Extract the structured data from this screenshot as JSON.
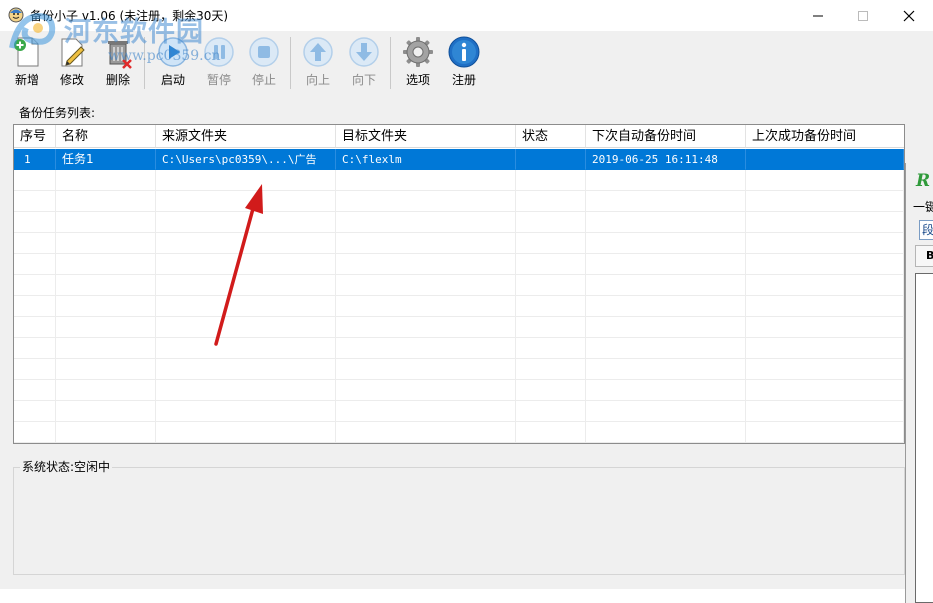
{
  "window": {
    "title": "备份小子 v1.06 (未注册，剩余30天)",
    "minimize_symbol": "—",
    "close_symbol": "✕"
  },
  "watermark": {
    "line1": "河东软件园",
    "line2": "www.pc0359.cn"
  },
  "toolbar": {
    "buttons": [
      {
        "label": "新增",
        "icon": "new-document-icon",
        "enabled": true
      },
      {
        "label": "修改",
        "icon": "edit-icon",
        "enabled": true
      },
      {
        "label": "删除",
        "icon": "delete-icon",
        "enabled": true
      },
      {
        "label": "启动",
        "icon": "play-icon",
        "enabled": true
      },
      {
        "label": "暂停",
        "icon": "pause-icon",
        "enabled": false
      },
      {
        "label": "停止",
        "icon": "stop-icon",
        "enabled": false
      },
      {
        "label": "向上",
        "icon": "arrow-up-icon",
        "enabled": false
      },
      {
        "label": "向下",
        "icon": "arrow-down-icon",
        "enabled": false
      },
      {
        "label": "选项",
        "icon": "gear-icon",
        "enabled": true
      },
      {
        "label": "注册",
        "icon": "info-icon",
        "enabled": true
      }
    ]
  },
  "task_list": {
    "section_label": "备份任务列表:",
    "columns": [
      "序号",
      "名称",
      "来源文件夹",
      "目标文件夹",
      "状态",
      "下次自动备份时间",
      "上次成功备份时间"
    ],
    "rows": [
      {
        "index": "1",
        "name": "任务1",
        "source": "C:\\Users\\pc0359\\...\\广告",
        "target": "C:\\flexlm",
        "status": "",
        "next_backup": "2019-06-25 16:11:48",
        "last_success": ""
      }
    ],
    "selected_row": 0
  },
  "system_status": {
    "label": "系统状态:空闲中"
  },
  "overlay_window": {
    "logo": "R",
    "text1": "一键",
    "box1": "段",
    "box2": "B"
  },
  "colors": {
    "selection": "#0078d7",
    "toolbar_bg": "#f0f0f0",
    "annotation_arrow": "#d11b1b",
    "icon_blue": "#2f86d4"
  }
}
